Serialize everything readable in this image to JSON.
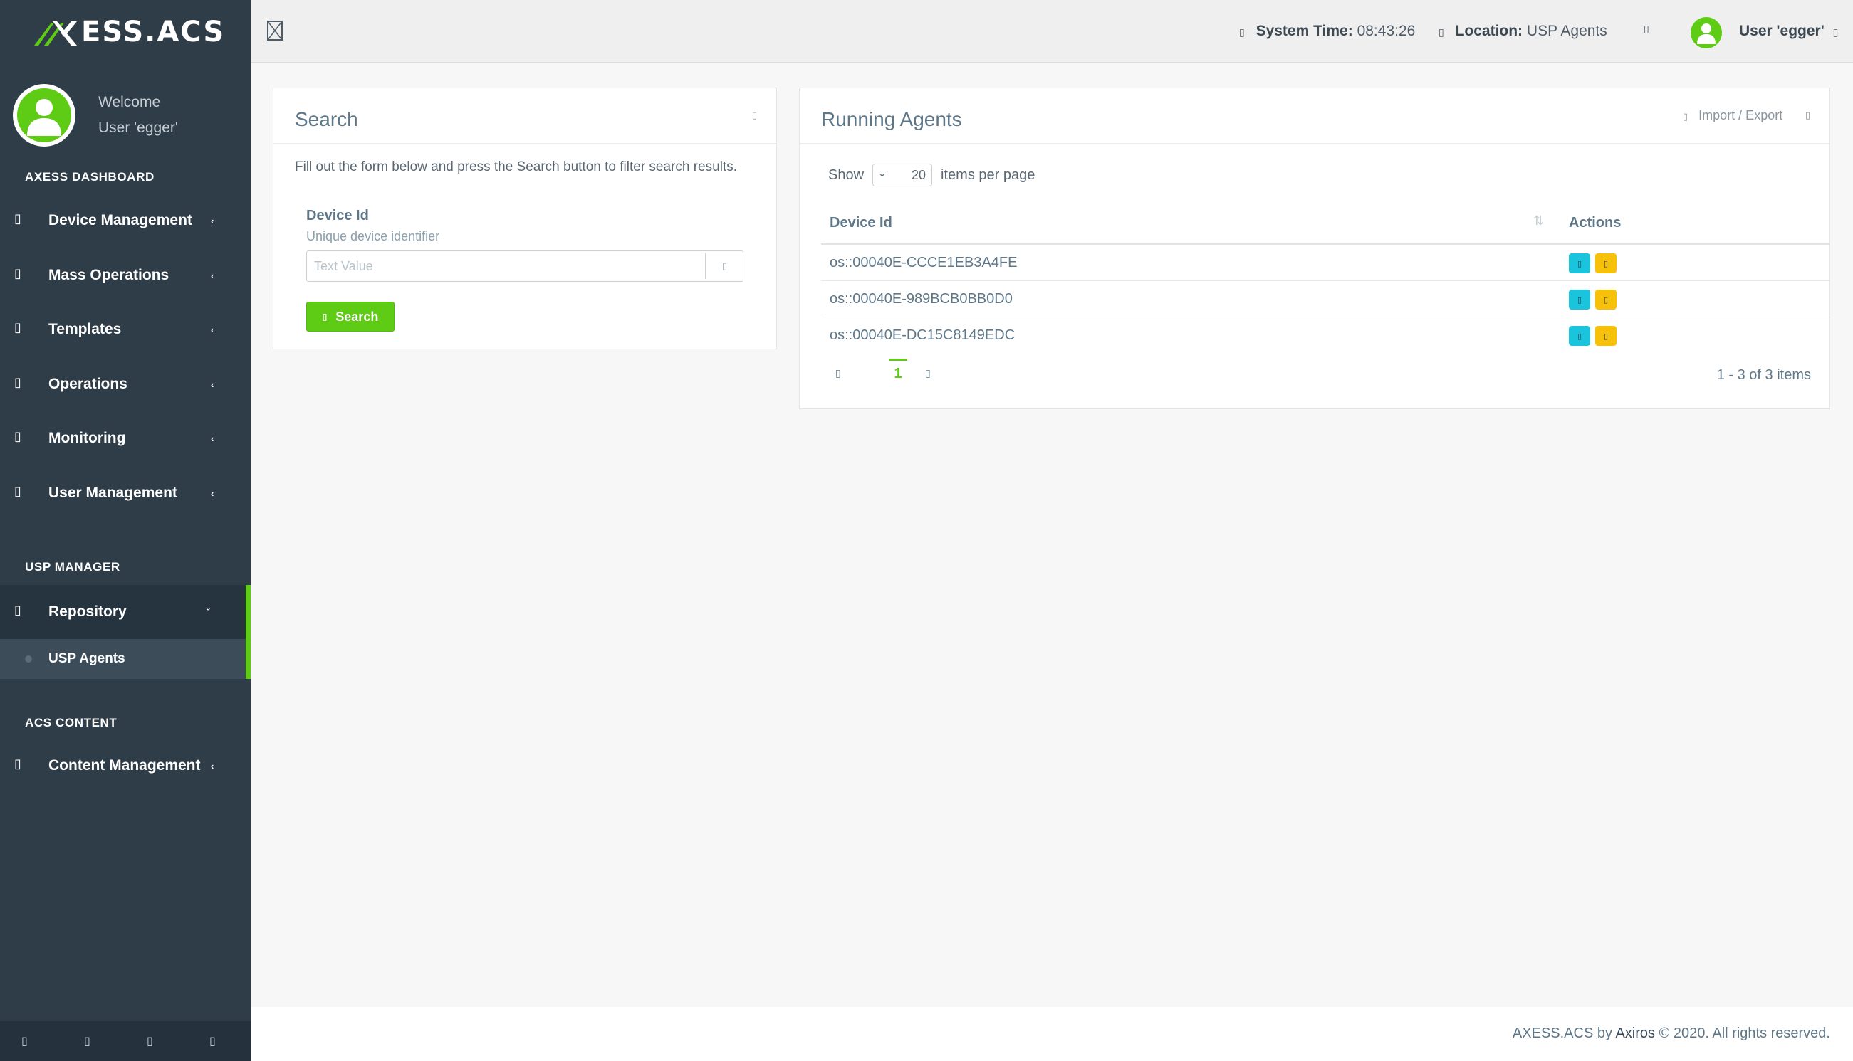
{
  "app": {
    "logo_text": "ESS.ACS",
    "brand_color": "#5ecb14",
    "sidebar_bg": "#2f3d49"
  },
  "profile": {
    "welcome": "Welcome",
    "user": "User 'egger'"
  },
  "sidebar": {
    "sections": {
      "dashboard": "AXESS DASHBOARD",
      "usp": "USP MANAGER",
      "acs": "ACS CONTENT"
    },
    "items": [
      {
        "label": "Device Management",
        "icon": "device-icon"
      },
      {
        "label": "Mass Operations",
        "icon": "mass-icon"
      },
      {
        "label": "Templates",
        "icon": "template-icon"
      },
      {
        "label": "Operations",
        "icon": "operations-icon"
      },
      {
        "label": "Monitoring",
        "icon": "monitoring-icon"
      },
      {
        "label": "User Management",
        "icon": "users-icon"
      },
      {
        "label": "Repository",
        "icon": "repository-icon"
      },
      {
        "label": "Content Management",
        "icon": "content-icon"
      }
    ],
    "sub_item": "USP Agents"
  },
  "header": {
    "system_time_label": "System Time:",
    "system_time_value": "08:43:26",
    "location_label": "Location:",
    "location_value": "USP Agents",
    "user": "User 'egger'"
  },
  "search_panel": {
    "title": "Search",
    "help": "Fill out the form below and press the Search button to filter search results.",
    "field_label": "Device Id",
    "field_hint": "Unique device identifier",
    "placeholder": "Text Value",
    "button": "Search"
  },
  "agents_panel": {
    "title": "Running Agents",
    "import_export": "Import / Export",
    "show": "Show",
    "per_page_value": "20",
    "items_per_page": "items per page",
    "columns": [
      "Device Id",
      "Actions"
    ],
    "rows": [
      {
        "device_id": "os::00040E-CCCE1EB3A4FE"
      },
      {
        "device_id": "os::00040E-989BCB0BB0D0"
      },
      {
        "device_id": "os::00040E-DC15C8149EDC"
      }
    ],
    "current_page": "1",
    "page_info": "1 - 3 of 3 items"
  },
  "footer": {
    "prefix": "AXESS.ACS by",
    "company": "Axiros",
    "suffix": "© 2020. All rights reserved."
  }
}
